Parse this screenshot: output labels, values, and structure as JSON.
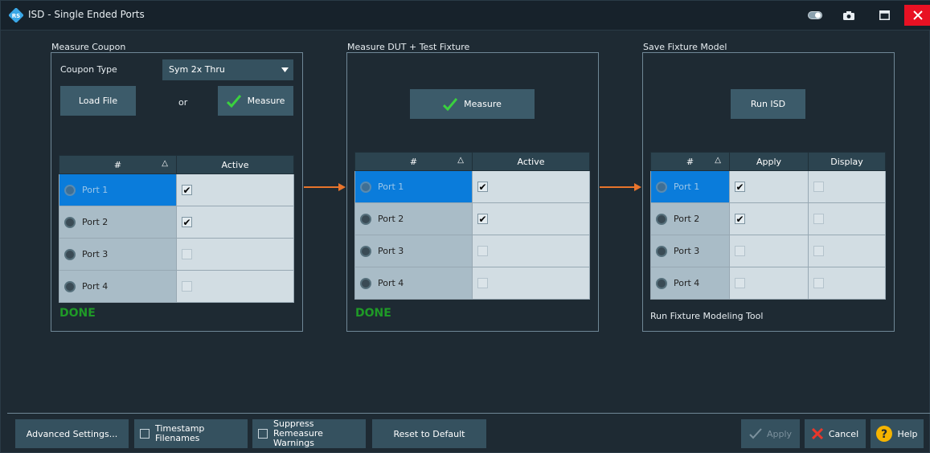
{
  "window": {
    "title": "ISD - Single Ended Ports"
  },
  "icons": {
    "logo": "rs-logo-icon",
    "toggle": "toggle-icon",
    "camera": "camera-icon",
    "maximize": "maximize-icon",
    "close": "close-icon"
  },
  "coupon": {
    "label": "Measure Coupon",
    "type_label": "Coupon Type",
    "type_value": "Sym 2x Thru",
    "load_file": "Load File",
    "or": "or",
    "measure": "Measure",
    "col_hash": "#",
    "col_active": "Active",
    "rows": [
      {
        "port": "Port 1",
        "active": true,
        "selected": true
      },
      {
        "port": "Port 2",
        "active": true,
        "selected": false
      },
      {
        "port": "Port 3",
        "active": false,
        "selected": false
      },
      {
        "port": "Port 4",
        "active": false,
        "selected": false
      }
    ],
    "status": "DONE"
  },
  "dut": {
    "label": "Measure DUT + Test Fixture",
    "measure": "Measure",
    "col_hash": "#",
    "col_active": "Active",
    "rows": [
      {
        "port": "Port 1",
        "active": true,
        "selected": true
      },
      {
        "port": "Port 2",
        "active": true,
        "selected": false
      },
      {
        "port": "Port 3",
        "active": false,
        "selected": false
      },
      {
        "port": "Port 4",
        "active": false,
        "selected": false
      }
    ],
    "status": "DONE"
  },
  "fixture": {
    "label": "Save Fixture Model",
    "run_isd": "Run ISD",
    "col_hash": "#",
    "col_apply": "Apply",
    "col_display": "Display",
    "rows": [
      {
        "port": "Port 1",
        "apply": true,
        "display": false,
        "selected": true
      },
      {
        "port": "Port 2",
        "apply": true,
        "display": false,
        "selected": false
      },
      {
        "port": "Port 3",
        "apply": false,
        "display": false,
        "selected": false
      },
      {
        "port": "Port 4",
        "apply": false,
        "display": false,
        "selected": false
      }
    ],
    "tool_label": "Run Fixture Modeling Tool"
  },
  "footer": {
    "advanced": "Advanced Settings...",
    "timestamp_line1": "Timestamp",
    "timestamp_line2": "Filenames",
    "suppress_line1": "Suppress Remeasure",
    "suppress_line2": "Warnings",
    "reset": "Reset to Default",
    "apply": "Apply",
    "cancel": "Cancel",
    "help": "Help"
  },
  "colors": {
    "accent_green": "#1f9a27",
    "arrow_orange": "#e8742c",
    "selected_blue": "#0a7cdb",
    "close_red": "#e81123",
    "help_yellow": "#f5b400"
  }
}
